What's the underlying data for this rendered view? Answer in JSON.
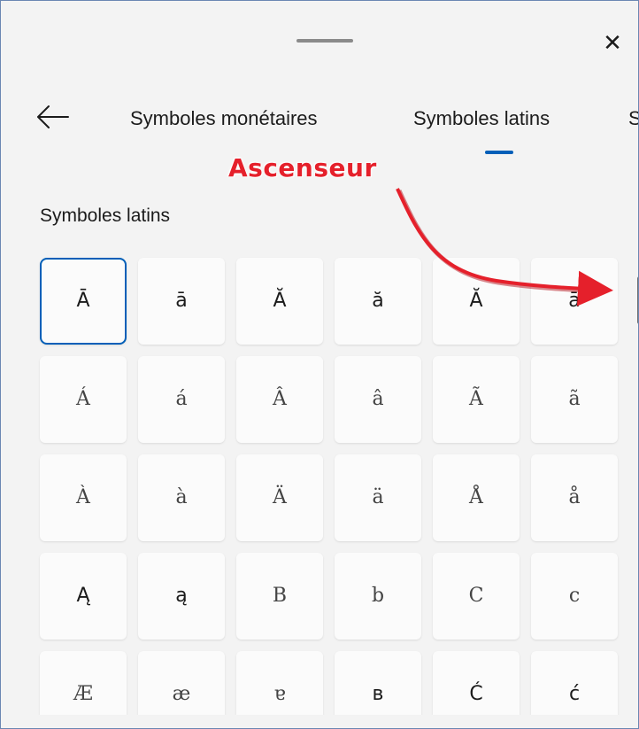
{
  "header": {
    "close_glyph": "✕"
  },
  "tabs": [
    {
      "label": "Symboles monétaires",
      "selected": false
    },
    {
      "label": "Symboles latins",
      "selected": true
    },
    {
      "label": "Sy",
      "selected": false
    }
  ],
  "section": {
    "title": "Symboles latins"
  },
  "symbols": [
    "Ā",
    "ā",
    "Ă",
    "ă",
    "Ă",
    "ā",
    "Á",
    "á",
    "Â",
    "â",
    "Ã",
    "ã",
    "À",
    "à",
    "Ä",
    "ä",
    "Å",
    "å",
    "Ą",
    "ą",
    "B",
    "b",
    "C",
    "c",
    "Æ",
    "æ",
    "ɐ",
    "в",
    "Ć",
    "ć"
  ],
  "selected_symbol_index": 0,
  "annotation": {
    "text": "Ascenseur",
    "color": "#e5202b"
  },
  "colors": {
    "accent": "#005fb8",
    "background": "#f3f3f3",
    "cell": "#fbfbfb"
  }
}
